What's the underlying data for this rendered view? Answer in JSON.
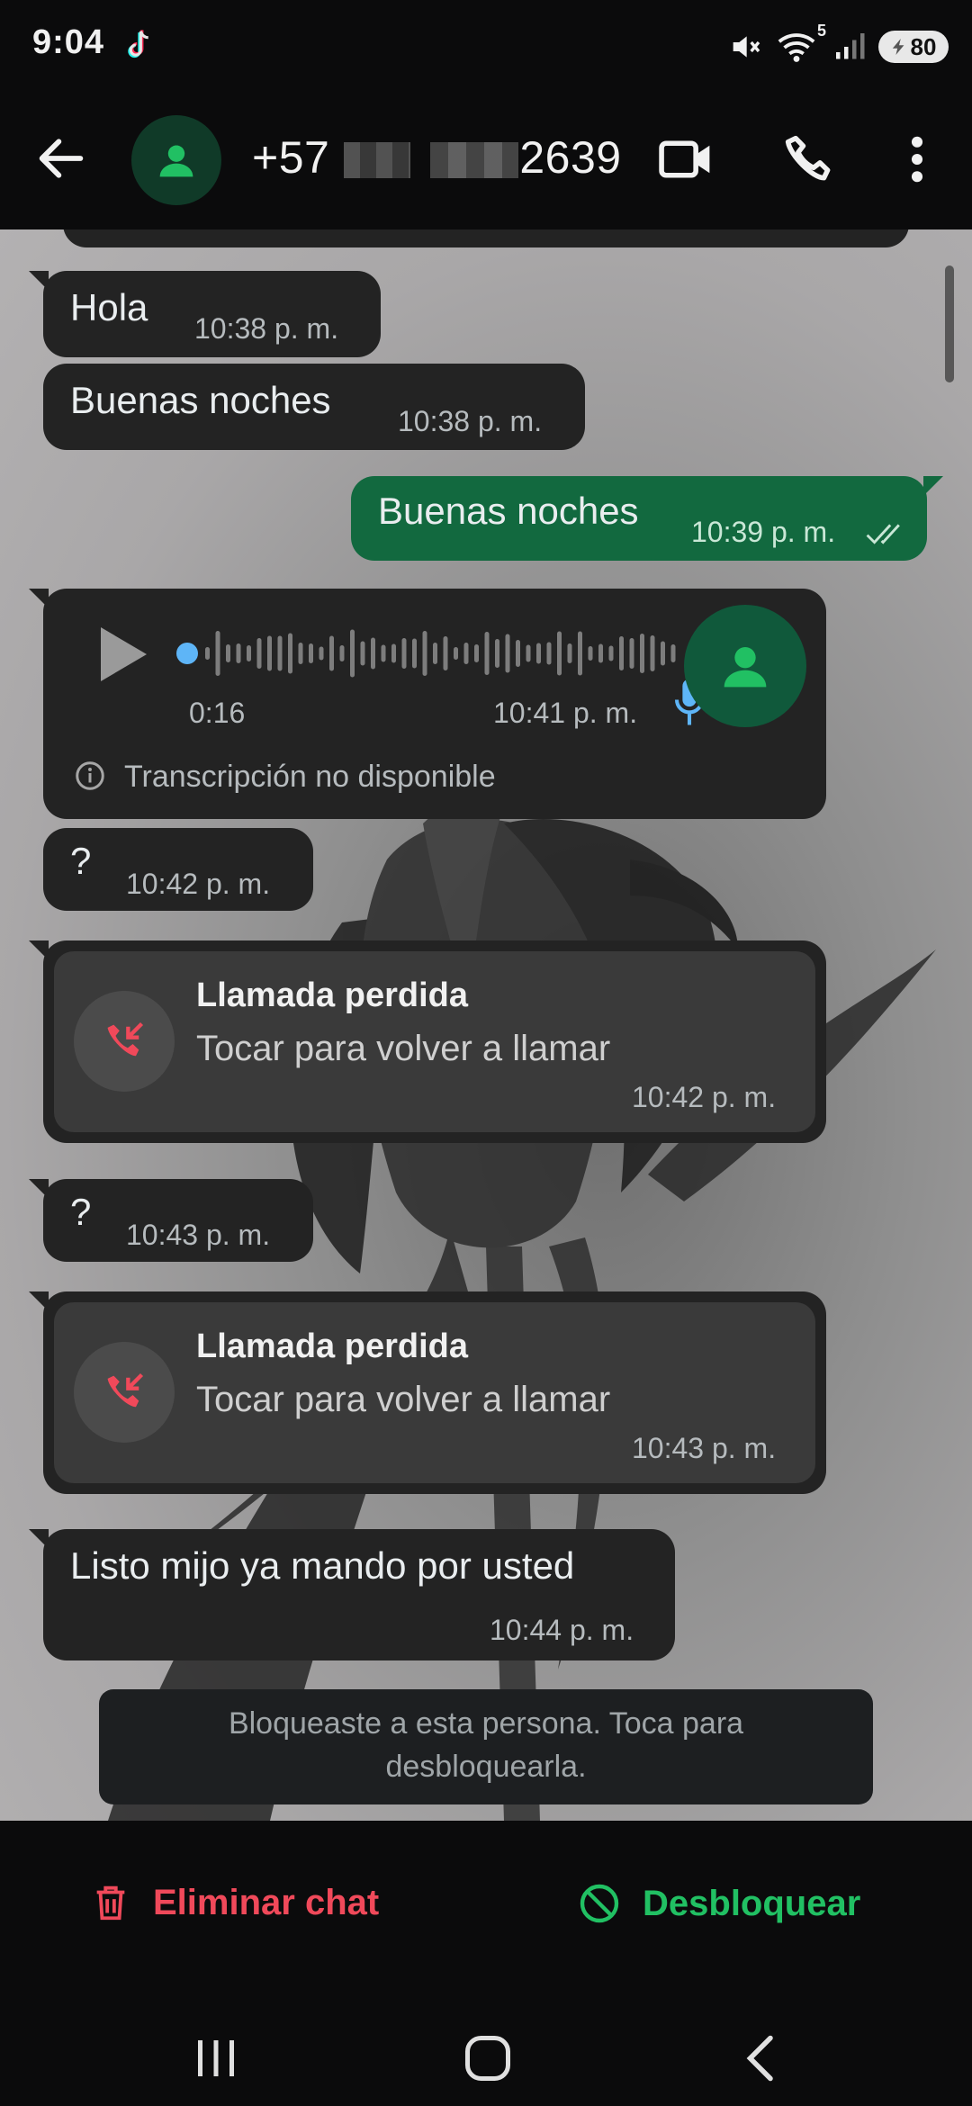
{
  "status_bar": {
    "time": "9:04",
    "network_label": "5",
    "battery": "80"
  },
  "header": {
    "contact_prefix": "+57",
    "contact_suffix": "2639"
  },
  "messages": [
    {
      "text": "Hola",
      "time": "10:38 p. m."
    },
    {
      "text": "Buenas noches",
      "time": "10:38 p. m."
    },
    {
      "text": "Buenas noches",
      "time": "10:39 p. m."
    },
    {
      "duration": "0:16",
      "time": "10:41 p. m.",
      "transcription": "Transcripción no disponible"
    },
    {
      "text": "?",
      "time": "10:42 p. m."
    },
    {
      "title": "Llamada perdida",
      "subtitle": "Tocar para volver a llamar",
      "time": "10:42 p. m."
    },
    {
      "text": "?",
      "time": "10:43 p. m."
    },
    {
      "title": "Llamada perdida",
      "subtitle": "Tocar para volver a llamar",
      "time": "10:43 p. m."
    },
    {
      "text": "Listo mijo ya mando por usted",
      "time": "10:44 p. m."
    }
  ],
  "blocked_notice": "Bloqueaste a esta persona. Toca para desbloquearla.",
  "actions": {
    "delete_label": "Eliminar chat",
    "unblock_label": "Desbloquear"
  },
  "colors": {
    "accent_green": "#21c063",
    "danger_red": "#f0495a",
    "outgoing_bubble": "#12693f",
    "incoming_bubble": "#232323"
  },
  "icons": [
    "tiktok-icon",
    "mute-icon",
    "wifi-icon",
    "signal-icon",
    "battery-icon",
    "back-arrow-icon",
    "person-icon",
    "video-call-icon",
    "phone-icon",
    "more-vert-icon",
    "play-icon",
    "mic-icon",
    "info-icon",
    "missed-call-icon",
    "trash-icon",
    "block-icon",
    "recents-icon",
    "home-icon",
    "nav-back-icon"
  ]
}
